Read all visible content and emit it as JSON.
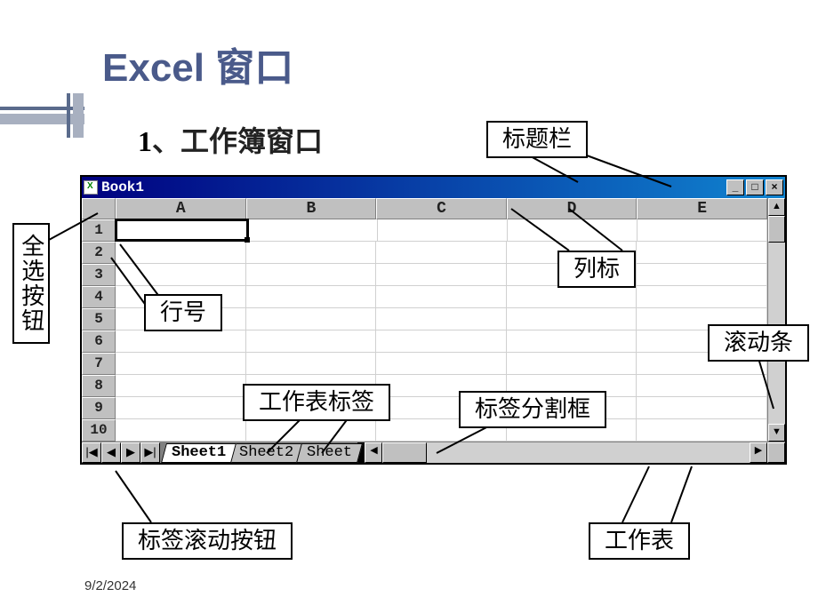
{
  "slide": {
    "title": "Excel 窗口",
    "subtitle_num": "1",
    "subtitle_suffix": "、工作簿窗口",
    "date": "9/2/2024"
  },
  "callouts": {
    "titlebar": "标题栏",
    "select_all": "全选按钮",
    "row_num": "行号",
    "col_label": "列标",
    "scrollbar": "滚动条",
    "sheet_tab": "工作表标签",
    "tab_split": "标签分割框",
    "tab_scroll": "标签滚动按钮",
    "worksheet": "工作表"
  },
  "excel": {
    "book_title": "Book1",
    "columns": [
      "A",
      "B",
      "C",
      "D",
      "E"
    ],
    "rows": [
      "1",
      "2",
      "3",
      "4",
      "5",
      "6",
      "7",
      "8",
      "9",
      "10"
    ],
    "tabs": [
      "Sheet1",
      "Sheet2",
      "Sheet"
    ],
    "nav": [
      "|◀",
      "◀",
      "▶",
      "▶|"
    ],
    "min_btn": "_",
    "max_btn": "□",
    "close_btn": "×",
    "up": "▲",
    "down": "▼",
    "left": "◀",
    "right": "▶"
  }
}
